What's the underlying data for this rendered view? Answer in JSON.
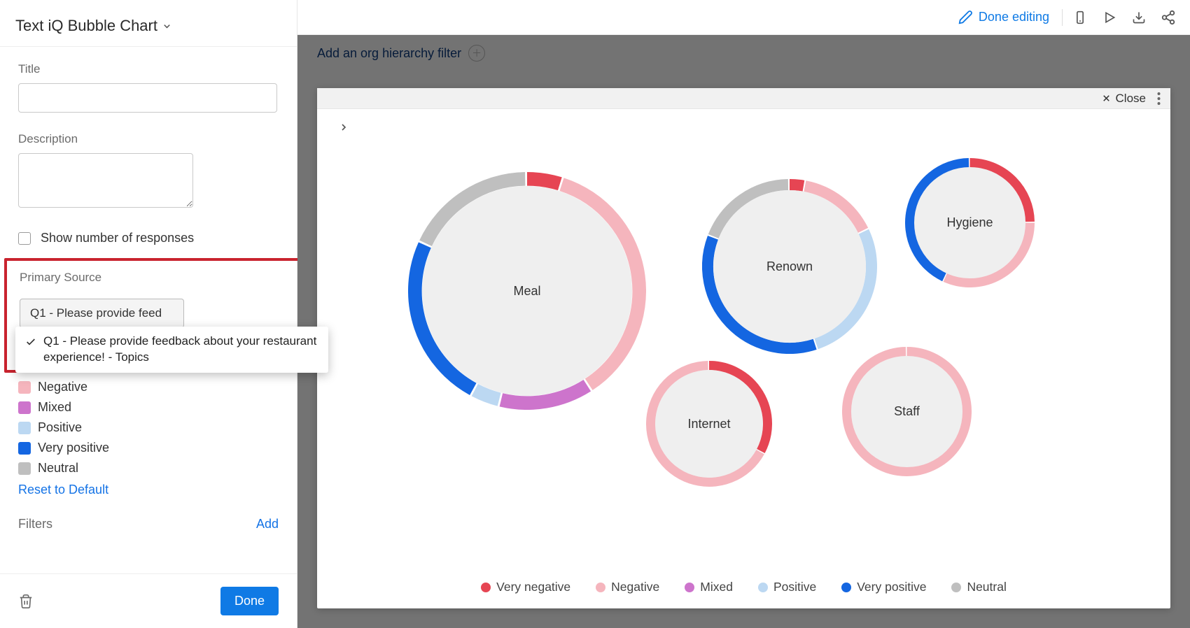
{
  "sidebar": {
    "page_title": "Text iQ Bubble Chart",
    "title_label": "Title",
    "title_value": "",
    "description_label": "Description",
    "description_value": "",
    "show_responses_label": "Show number of responses",
    "primary_source_label": "Primary Source",
    "primary_source_selected": "Q1 - Please provide feed",
    "primary_source_option": "Q1 - Please provide feedback about your restaurant experience! - Topics",
    "legend_items": [
      {
        "label": "Negative",
        "color": "#f5b5bd"
      },
      {
        "label": "Mixed",
        "color": "#cd74cc"
      },
      {
        "label": "Positive",
        "color": "#bcd8f2"
      },
      {
        "label": "Very positive",
        "color": "#1466e1"
      },
      {
        "label": "Neutral",
        "color": "#bfbfbf"
      }
    ],
    "reset_label": "Reset to Default",
    "filters_label": "Filters",
    "add_label": "Add",
    "done_label": "Done"
  },
  "topbar": {
    "done_editing": "Done editing"
  },
  "filter_bar": {
    "add_hierarchy": "Add an org hierarchy filter"
  },
  "card": {
    "close_label": "Close"
  },
  "chart_legend": [
    {
      "label": "Very negative",
      "color": "#e64553"
    },
    {
      "label": "Negative",
      "color": "#f5b5bd"
    },
    {
      "label": "Mixed",
      "color": "#cd74cc"
    },
    {
      "label": "Positive",
      "color": "#bcd8f2"
    },
    {
      "label": "Very positive",
      "color": "#1466e1"
    },
    {
      "label": "Neutral",
      "color": "#bfbfbf"
    }
  ],
  "chart_data": {
    "type": "pie",
    "title": "",
    "legend": [
      "Very negative",
      "Negative",
      "Mixed",
      "Positive",
      "Very positive",
      "Neutral"
    ],
    "colors": {
      "Very negative": "#e64553",
      "Negative": "#f5b5bd",
      "Mixed": "#cd74cc",
      "Positive": "#bcd8f2",
      "Very positive": "#1466e1",
      "Neutral": "#bfbfbf"
    },
    "series": [
      {
        "name": "Meal",
        "size": 340,
        "values": {
          "Very negative": 5,
          "Negative": 36,
          "Mixed": 13,
          "Positive": 4,
          "Very positive": 24,
          "Neutral": 18
        }
      },
      {
        "name": "Renown",
        "size": 250,
        "values": {
          "Very negative": 3,
          "Negative": 15,
          "Mixed": 0,
          "Positive": 27,
          "Very positive": 36,
          "Neutral": 19
        }
      },
      {
        "name": "Hygiene",
        "size": 185,
        "values": {
          "Very negative": 25,
          "Negative": 32,
          "Mixed": 0,
          "Positive": 0,
          "Very positive": 43,
          "Neutral": 0
        }
      },
      {
        "name": "Internet",
        "size": 180,
        "values": {
          "Very negative": 33,
          "Negative": 67,
          "Mixed": 0,
          "Positive": 0,
          "Very positive": 0,
          "Neutral": 0
        }
      },
      {
        "name": "Staff",
        "size": 185,
        "values": {
          "Very negative": 0,
          "Negative": 100,
          "Mixed": 0,
          "Positive": 0,
          "Very positive": 0,
          "Neutral": 0
        }
      }
    ]
  }
}
